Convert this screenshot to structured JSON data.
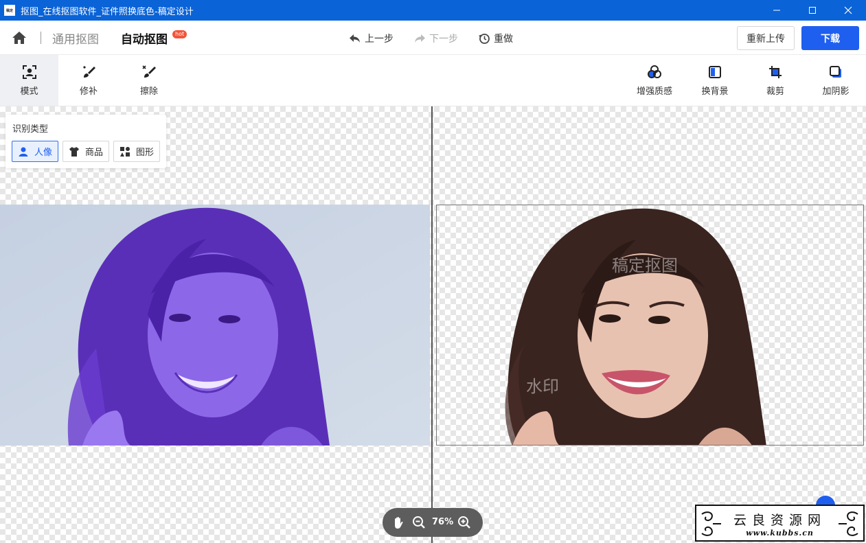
{
  "window": {
    "title": "抠图_在线抠图软件_证件照换底色-稿定设计",
    "app_icon_text": "稿定"
  },
  "nav": {
    "tab_general": "通用抠图",
    "tab_auto": "自动抠图",
    "hot_badge": "hot",
    "undo": "上一步",
    "redo": "下一步",
    "reset": "重做",
    "reupload": "重新上传",
    "download": "下载"
  },
  "toolbar": {
    "left": [
      {
        "label": "模式",
        "icon": "portrait-frame-icon"
      },
      {
        "label": "修补",
        "icon": "brush-icon"
      },
      {
        "label": "擦除",
        "icon": "eraser-icon"
      }
    ],
    "right": [
      {
        "label": "增强质感",
        "icon": "circles-icon"
      },
      {
        "label": "换背景",
        "icon": "background-icon"
      },
      {
        "label": "裁剪",
        "icon": "crop-icon"
      },
      {
        "label": "加阴影",
        "icon": "shadow-icon"
      }
    ]
  },
  "recognition_panel": {
    "title": "识别类型",
    "types": [
      {
        "label": "人像",
        "icon": "person-icon",
        "selected": true
      },
      {
        "label": "商品",
        "icon": "tshirt-icon",
        "selected": false
      },
      {
        "label": "图形",
        "icon": "shapes-icon",
        "selected": false
      }
    ]
  },
  "preview": {
    "watermark_1": "稿定抠图",
    "watermark_2": "水印"
  },
  "zoom": {
    "value": "76%"
  },
  "site_logo": {
    "cn": "云良资源网",
    "en": "www.kubbs.cn"
  },
  "colors": {
    "titlebar": "#0a63d7",
    "primary": "#1f5ff0",
    "hot": "#f2553a",
    "mask_overlay": "#6a3df0"
  }
}
